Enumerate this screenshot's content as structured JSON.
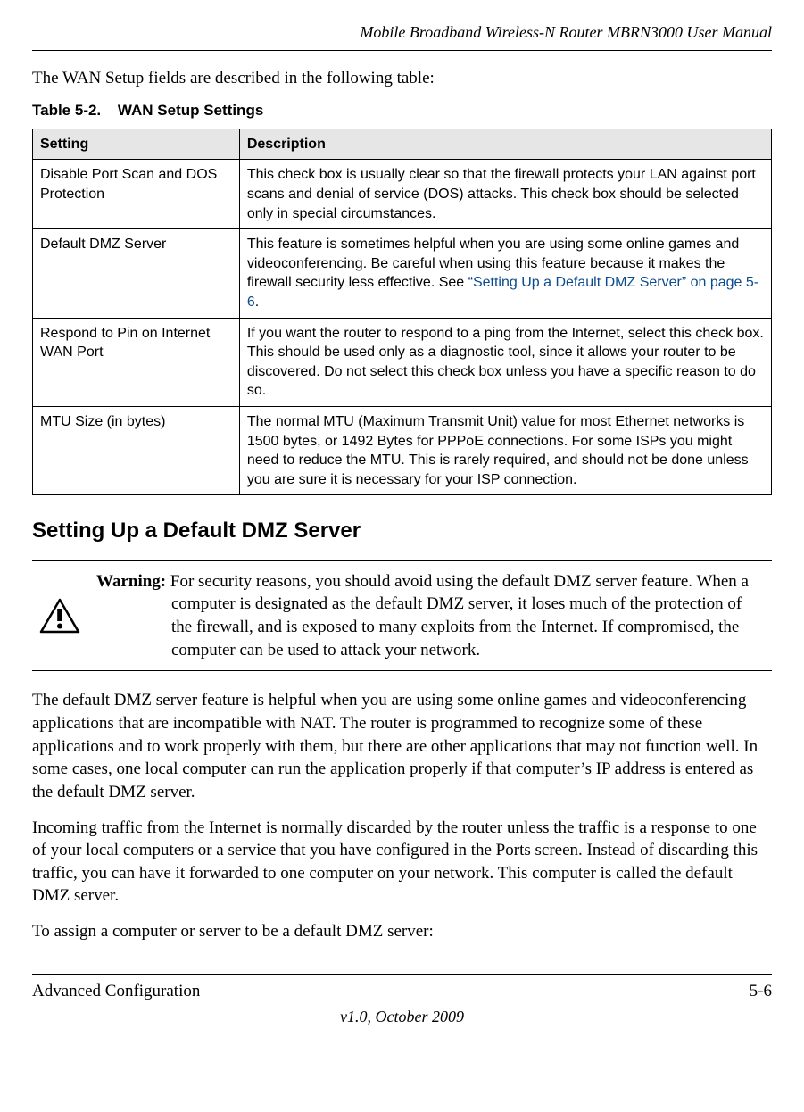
{
  "header_title": "Mobile Broadband Wireless-N Router MBRN3000 User Manual",
  "intro": "The WAN Setup fields are described in the following table:",
  "table_caption_num": "Table 5-2.",
  "table_caption_title": "WAN Setup Settings",
  "columns": {
    "c0": "Setting",
    "c1": "Description"
  },
  "rows": [
    {
      "setting": "Disable Port Scan and DOS Protection",
      "desc": "This check box is usually clear so that the firewall protects your LAN against port scans and denial of service (DOS) attacks. This check box should be selected only in special circumstances."
    },
    {
      "setting": "Default DMZ Server",
      "desc_pre": "This feature is sometimes helpful when you are using some online games and videoconferencing. Be careful when using this feature because it makes the firewall security less effective. See ",
      "link": "“Setting Up a Default DMZ Server” on page 5-6",
      "desc_post": "."
    },
    {
      "setting": "Respond to Pin on Internet WAN Port",
      "desc": "If you want the router to respond to a ping from the Internet, select this check box. This should be used only as a diagnostic tool, since it allows your router to be discovered. Do not select this check box unless you have a specific reason to do so."
    },
    {
      "setting": "MTU Size (in bytes)",
      "desc": "The normal MTU (Maximum Transmit Unit) value for most Ethernet networks is 1500 bytes, or 1492 Bytes for PPPoE connections. For some ISPs you might need to reduce the MTU. This is rarely required, and should not be done unless you are sure it is necessary for your ISP connection."
    }
  ],
  "section_heading": "Setting Up a Default DMZ Server",
  "warning_label": "Warning:",
  "warning_text": " For security reasons, you should avoid using the default DMZ server feature. When a computer is designated as the default DMZ server, it loses much of the protection of the firewall, and is exposed to many exploits from the Internet. If compromised, the computer can be used to attack your network.",
  "para1": "The default DMZ server feature is helpful when you are using some online games and videoconferencing applications that are incompatible with NAT. The router is programmed to recognize some of these applications and to work properly with them, but there are other applications that may not function well. In some cases, one local computer can run the application properly if that computer’s IP address is entered as the default DMZ server.",
  "para2": "Incoming traffic from the Internet is normally discarded by the router unless the traffic is a response to one of your local computers or a service that you have configured in the Ports screen. Instead of discarding this traffic, you can have it forwarded to one computer on your network. This computer is called the default DMZ server.",
  "para3": "To assign a computer or server to be a default DMZ server:",
  "footer_left": "Advanced Configuration",
  "footer_right": "5-6",
  "footer_center": "v1.0, October 2009"
}
